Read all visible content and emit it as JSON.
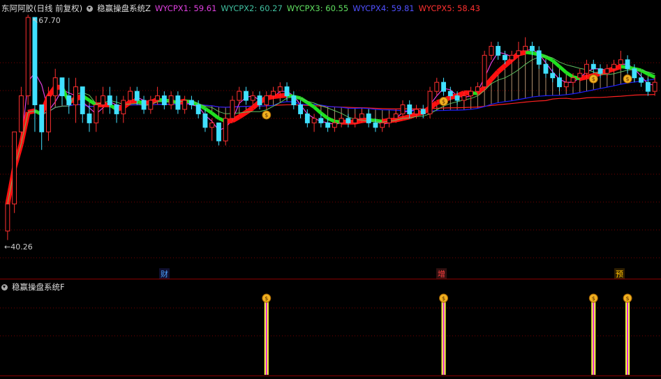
{
  "header": {
    "stock": "东阿阿胶(日线 前复权)",
    "indicator": "稳赢操盘系统Z",
    "lines": [
      {
        "label": "WYCPX1: 59.61",
        "color": "#e040e0"
      },
      {
        "label": "WYCPX2: 60.27",
        "color": "#40c0a0"
      },
      {
        "label": "WYCPX3: 60.55",
        "color": "#60e060"
      },
      {
        "label": "WYCPX4: 59.81",
        "color": "#3030ff"
      },
      {
        "label": "WYCPX5: 58.43",
        "color": "#ff3030"
      }
    ]
  },
  "price_labels": {
    "high": "67.70",
    "low": "40.26"
  },
  "markers": [
    {
      "text": "财",
      "color": "#4aa0ff"
    },
    {
      "text": "增",
      "color": "#ff4040"
    },
    {
      "text": "预",
      "color": "#ffc000"
    }
  ],
  "sub_panel": {
    "title": "稳赢操盘系统F"
  },
  "colors": {
    "up": "#ff3030",
    "down": "#40e0ff",
    "grid": "#8a0000"
  },
  "chart_data": {
    "type": "candlestick",
    "y_range": [
      40.26,
      67.7
    ],
    "candles": [
      [
        44,
        47,
        43,
        47
      ],
      [
        47,
        55,
        46,
        55
      ],
      [
        55,
        60,
        54,
        59
      ],
      [
        59,
        68,
        58,
        67.7
      ],
      [
        67.7,
        67.7,
        55,
        58
      ],
      [
        58,
        58,
        53,
        55
      ],
      [
        55,
        60,
        54,
        59
      ],
      [
        59,
        62,
        58,
        61
      ],
      [
        61,
        61,
        58,
        59
      ],
      [
        59,
        61,
        57,
        58
      ],
      [
        58,
        61,
        56,
        60
      ],
      [
        60,
        60,
        56,
        57
      ],
      [
        57,
        58,
        55,
        56
      ],
      [
        56,
        59,
        55,
        58
      ],
      [
        58,
        60,
        57,
        59
      ],
      [
        59,
        60,
        57,
        58
      ],
      [
        58,
        59,
        56,
        57
      ],
      [
        57,
        59,
        56,
        58.5
      ],
      [
        58.5,
        60,
        58,
        59.5
      ],
      [
        59.5,
        60,
        58,
        58.5
      ],
      [
        58.5,
        59,
        57,
        57.5
      ],
      [
        57.5,
        59,
        57,
        58.5
      ],
      [
        58.5,
        60,
        58,
        59
      ],
      [
        59,
        59.5,
        57.5,
        58
      ],
      [
        58,
        59.5,
        57.5,
        59
      ],
      [
        59,
        59.5,
        57,
        57.5
      ],
      [
        57.5,
        59,
        57,
        58.5
      ],
      [
        58.5,
        59,
        57.5,
        58
      ],
      [
        58,
        58.5,
        56.5,
        57
      ],
      [
        57,
        57.5,
        55,
        55.5
      ],
      [
        55.5,
        56.5,
        54,
        56
      ],
      [
        56,
        56,
        53.5,
        54
      ],
      [
        54,
        57,
        53.5,
        56.5
      ],
      [
        56.5,
        59,
        56,
        58.5
      ],
      [
        58.5,
        60,
        58,
        59.5
      ],
      [
        59.5,
        60,
        58,
        58.5
      ],
      [
        58.5,
        59.5,
        58,
        59
      ],
      [
        59,
        59.5,
        57.5,
        58
      ],
      [
        58,
        59.5,
        57.5,
        59
      ],
      [
        59,
        60,
        58.5,
        59.5
      ],
      [
        59.5,
        60.5,
        59,
        60
      ],
      [
        60,
        60.5,
        58.5,
        59
      ],
      [
        59,
        59.5,
        57.5,
        58
      ],
      [
        58,
        58.5,
        56.5,
        57
      ],
      [
        57,
        57.5,
        55.5,
        56
      ],
      [
        56,
        57,
        55,
        56.5
      ],
      [
        56.5,
        57,
        55.5,
        56
      ],
      [
        56,
        56.5,
        55,
        55.5
      ],
      [
        55.5,
        56.5,
        55,
        56
      ],
      [
        56,
        57,
        55.5,
        56.5
      ],
      [
        56.5,
        57,
        55.5,
        56
      ],
      [
        56,
        57,
        55.5,
        56.5
      ],
      [
        56.5,
        57.5,
        56,
        57
      ],
      [
        57,
        57.5,
        55.5,
        56
      ],
      [
        56,
        56.5,
        55,
        55.5
      ],
      [
        55.5,
        56.5,
        55,
        56
      ],
      [
        56,
        57,
        55.5,
        56.5
      ],
      [
        56.5,
        57.5,
        56,
        57
      ],
      [
        57,
        58.5,
        56.5,
        58
      ],
      [
        58,
        58.5,
        56.5,
        57
      ],
      [
        57,
        58,
        56.5,
        57.5
      ],
      [
        57.5,
        58,
        56.5,
        57
      ],
      [
        57,
        60,
        56.5,
        59.5
      ],
      [
        59.5,
        61,
        59,
        60.5
      ],
      [
        60.5,
        61,
        59,
        59.5
      ],
      [
        59.5,
        60,
        58.5,
        59
      ],
      [
        59,
        59.5,
        58,
        58.5
      ],
      [
        58.5,
        59.5,
        58,
        59
      ],
      [
        59,
        60,
        58.5,
        59.5
      ],
      [
        59.5,
        60.5,
        59,
        60
      ],
      [
        60,
        64,
        59.5,
        63.5
      ],
      [
        63.5,
        65,
        63,
        64.5
      ],
      [
        64.5,
        65,
        63,
        63.5
      ],
      [
        63.5,
        64,
        62.5,
        63
      ],
      [
        63,
        64,
        62.5,
        63.5
      ],
      [
        63.5,
        65,
        63,
        64
      ],
      [
        64,
        65.5,
        63.5,
        64.5
      ],
      [
        64.5,
        65,
        63.5,
        64
      ],
      [
        64,
        64.5,
        62,
        62.5
      ],
      [
        62.5,
        63,
        61,
        61.5
      ],
      [
        61.5,
        62,
        60.5,
        61
      ],
      [
        61,
        61.5,
        59.5,
        60
      ],
      [
        60,
        61,
        59.5,
        60.5
      ],
      [
        60.5,
        61.5,
        60,
        61
      ],
      [
        61,
        62,
        60.5,
        61.5
      ],
      [
        61.5,
        63,
        61,
        62.5
      ],
      [
        62.5,
        63,
        61.5,
        62
      ],
      [
        62,
        62.5,
        61,
        61.5
      ],
      [
        61.5,
        62.5,
        61,
        62
      ],
      [
        62,
        63,
        61.5,
        62.5
      ],
      [
        62.5,
        64,
        62,
        63
      ],
      [
        63,
        63.5,
        61.5,
        62
      ],
      [
        62,
        62.5,
        60.5,
        61
      ],
      [
        61,
        61.5,
        60,
        60.5
      ],
      [
        60.5,
        61,
        59,
        59.5
      ],
      [
        59.5,
        61,
        59,
        60.5
      ]
    ],
    "signal_indices": [
      38,
      64,
      86,
      91
    ]
  }
}
